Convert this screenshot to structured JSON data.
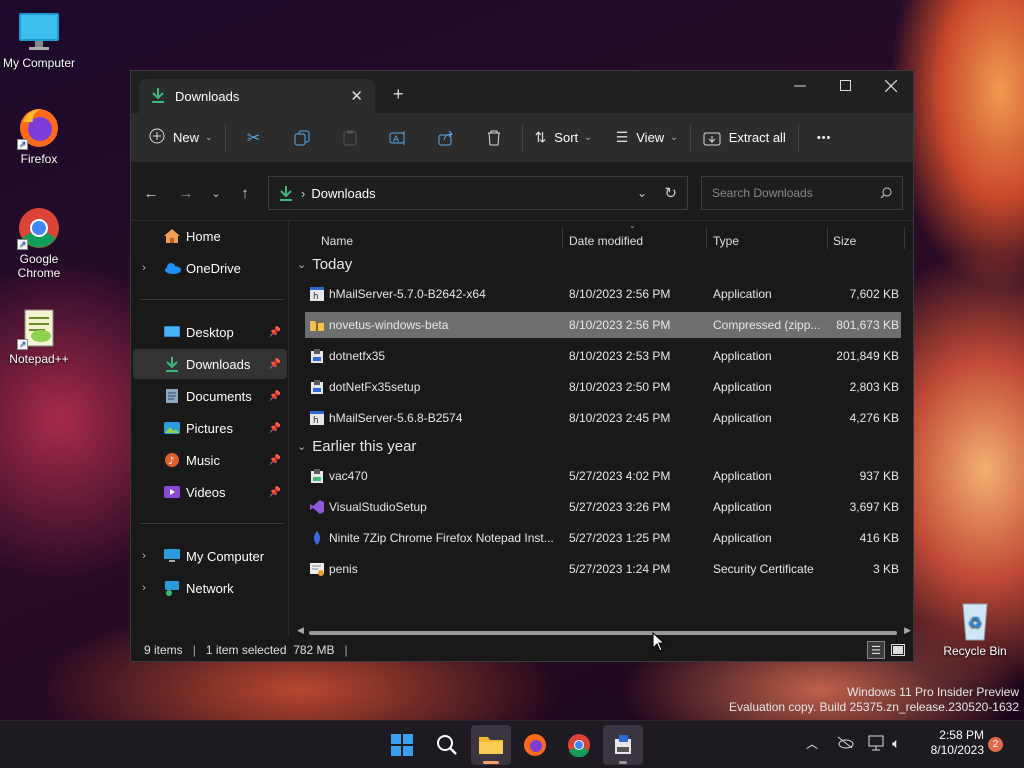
{
  "desktop": {
    "icons": [
      {
        "label": "My Computer",
        "icon": "monitor-icon"
      },
      {
        "label": "Firefox",
        "icon": "firefox-icon"
      },
      {
        "label": "Google Chrome",
        "icon": "chrome-icon"
      },
      {
        "label": "Notepad++",
        "icon": "notepad-plus-plus-icon"
      },
      {
        "label": "Recycle Bin",
        "icon": "recycle-bin-icon"
      }
    ],
    "watermark_line1": "Windows 11 Pro Insider Preview",
    "watermark_line2": "Evaluation copy. Build 25375.zn_release.230520-1632"
  },
  "window": {
    "tab_title": "Downloads",
    "toolbar": {
      "new_label": "New",
      "sort_label": "Sort",
      "view_label": "View",
      "extract_label": "Extract all",
      "more_label": "•••"
    },
    "address": {
      "path": "Downloads",
      "search_placeholder": "Search Downloads"
    },
    "sidebar": {
      "items": [
        {
          "label": "Home"
        },
        {
          "label": "OneDrive"
        },
        {
          "label": "Desktop"
        },
        {
          "label": "Downloads"
        },
        {
          "label": "Documents"
        },
        {
          "label": "Pictures"
        },
        {
          "label": "Music"
        },
        {
          "label": "Videos"
        },
        {
          "label": "My Computer"
        },
        {
          "label": "Network"
        }
      ]
    },
    "columns": {
      "name": "Name",
      "date": "Date modified",
      "type": "Type",
      "size": "Size"
    },
    "groups": {
      "today": "Today",
      "earlier": "Earlier this year"
    },
    "files": [
      {
        "name": "hMailServer-5.7.0-B2642-x64",
        "date": "8/10/2023 2:56 PM",
        "type": "Application",
        "size": "7,602 KB"
      },
      {
        "name": "novetus-windows-beta",
        "date": "8/10/2023 2:56 PM",
        "type": "Compressed (zipp...",
        "size": "801,673 KB"
      },
      {
        "name": "dotnetfx35",
        "date": "8/10/2023 2:53 PM",
        "type": "Application",
        "size": "201,849 KB"
      },
      {
        "name": "dotNetFx35setup",
        "date": "8/10/2023 2:50 PM",
        "type": "Application",
        "size": "2,803 KB"
      },
      {
        "name": "hMailServer-5.6.8-B2574",
        "date": "8/10/2023 2:45 PM",
        "type": "Application",
        "size": "4,276 KB"
      },
      {
        "name": "vac470",
        "date": "5/27/2023 4:02 PM",
        "type": "Application",
        "size": "937 KB"
      },
      {
        "name": "VisualStudioSetup",
        "date": "5/27/2023 3:26 PM",
        "type": "Application",
        "size": "3,697 KB"
      },
      {
        "name": "Ninite 7Zip Chrome Firefox Notepad Inst...",
        "date": "5/27/2023 1:25 PM",
        "type": "Application",
        "size": "416 KB"
      },
      {
        "name": "penis",
        "date": "5/27/2023 1:24 PM",
        "type": "Security Certificate",
        "size": "3 KB"
      }
    ],
    "status": {
      "count": "9 items",
      "selection": "1 item selected  782 MB"
    }
  },
  "taskbar": {
    "time": "2:58 PM",
    "date": "8/10/2023",
    "notification_count": "2"
  },
  "colors": {
    "accent": "#0078d4",
    "selection": "#6e6e6e",
    "download_green": "#3dba7a"
  }
}
